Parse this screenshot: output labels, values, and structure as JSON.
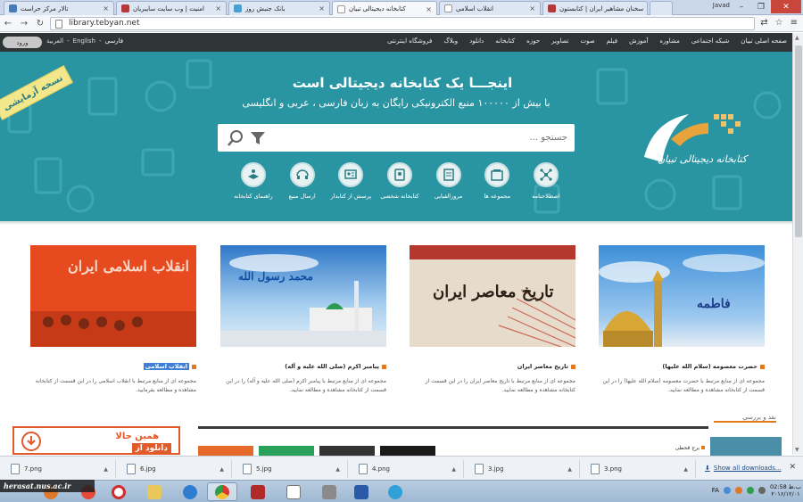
{
  "browser": {
    "tabs": [
      {
        "label": "تالار مرکز حراست",
        "color": "#4a7ab5"
      },
      {
        "label": "امنیت | وب سایت سایبریان",
        "color": "#b23a3a"
      },
      {
        "label": "بانک جنبش روز",
        "color": "#4aa0d0"
      },
      {
        "label": "کتابخانه دیجیتالی تبیان",
        "color": "#cccccc"
      },
      {
        "label": "انقلاب اسلامی",
        "color": "#cccccc"
      },
      {
        "label": "سخنان مشاهیر ایران | کتابستون",
        "color": "#b23a3a"
      }
    ],
    "user": "Javad",
    "url": "library.tebyan.net"
  },
  "site_nav": {
    "login": "ورود",
    "langs": [
      "العربية",
      "English",
      "فارسی"
    ],
    "menu": [
      "صفحه اصلی تبیان",
      "شبکه اجتماعی",
      "مشاوره",
      "آموزش",
      "فیلم",
      "صوت",
      "تصاویر",
      "حوزه",
      "کتابخانه",
      "دانلود",
      "وبلاگ",
      "فروشگاه اینترنتی"
    ]
  },
  "hero": {
    "title": "اینجـــا یک کتابخانه دیجیتالی است",
    "subtitle": "با بیش از ۱۰۰۰۰۰ منبع الکترونیکی رایگان به زبان فارسی ، عربی و انگلیسی",
    "search_placeholder": "جستجو ...",
    "trial_badge": "نسخه آزمایشی",
    "logo_text": "کتابخانه دیجیتالی تبیان",
    "features": [
      {
        "label": "اصطلاحنامه",
        "icon": "thesaurus-icon"
      },
      {
        "label": "مجموعه ها",
        "icon": "collections-icon"
      },
      {
        "label": "مرورالفبایی",
        "icon": "alphabet-browse-icon"
      },
      {
        "label": "کتابخانه شخصی",
        "icon": "personal-library-icon"
      },
      {
        "label": "پرسش از کتابدار",
        "icon": "ask-librarian-icon"
      },
      {
        "label": "ارسال منبع",
        "icon": "upload-source-icon"
      },
      {
        "label": "راهنمای کتابخانه",
        "icon": "library-guide-icon"
      }
    ]
  },
  "cards": [
    {
      "title": "حضرت معصومه (سلام الله علیها)",
      "desc": "مجموعه ای از منابع مرتبط با حضرت معصومه (سلام الله علیها) را در این قسمت از کتابخانه مشاهده و مطالعه نمایید.",
      "img_text": "فاطمه"
    },
    {
      "title": "تاریخ معاصر ایران",
      "desc": "مجموعه ای از منابع مرتبط با تاریخ معاصر ایران را در این قسمت از کتابخانه مشاهده و مطالعه نمایید.",
      "img_text": "تاریخ معاصر ایران"
    },
    {
      "title": "پیامبر اکرم (صلی الله علیه و آله)",
      "desc": "مجموعه ای از منابع مرتبط با پیامبر اکرم (صلی الله علیه و آله) را در این قسمت از کتابخانه مشاهده و مطالعه نمایید.",
      "img_text": "محمد رسول الله"
    },
    {
      "title": "انقلاب اسلامی",
      "desc": "مجموعه ای از منابع مرتبط با انقلاب اسلامی را در این قسمت از کتابخانه مشاهده و مطالعه بفرمایید.",
      "img_text": "انقلاب اسلامی ایران"
    }
  ],
  "download_ad": {
    "line1": "همین حالا",
    "line2": "دانلود از"
  },
  "review": {
    "title": "نقد و بررسی",
    "item": "برج قحطی"
  },
  "downloads": [
    "7.png",
    "6.jpg",
    "5.jpg",
    "4.png",
    "3.jpg",
    "3.png"
  ],
  "show_all": "Show all downloads...",
  "taskbar": {
    "watermark": "herasat.nus.ac.ir",
    "lang": "FA",
    "time": "02:58 ب.ظ",
    "date": "۲۰۱۶/۱۲/۰۱"
  }
}
